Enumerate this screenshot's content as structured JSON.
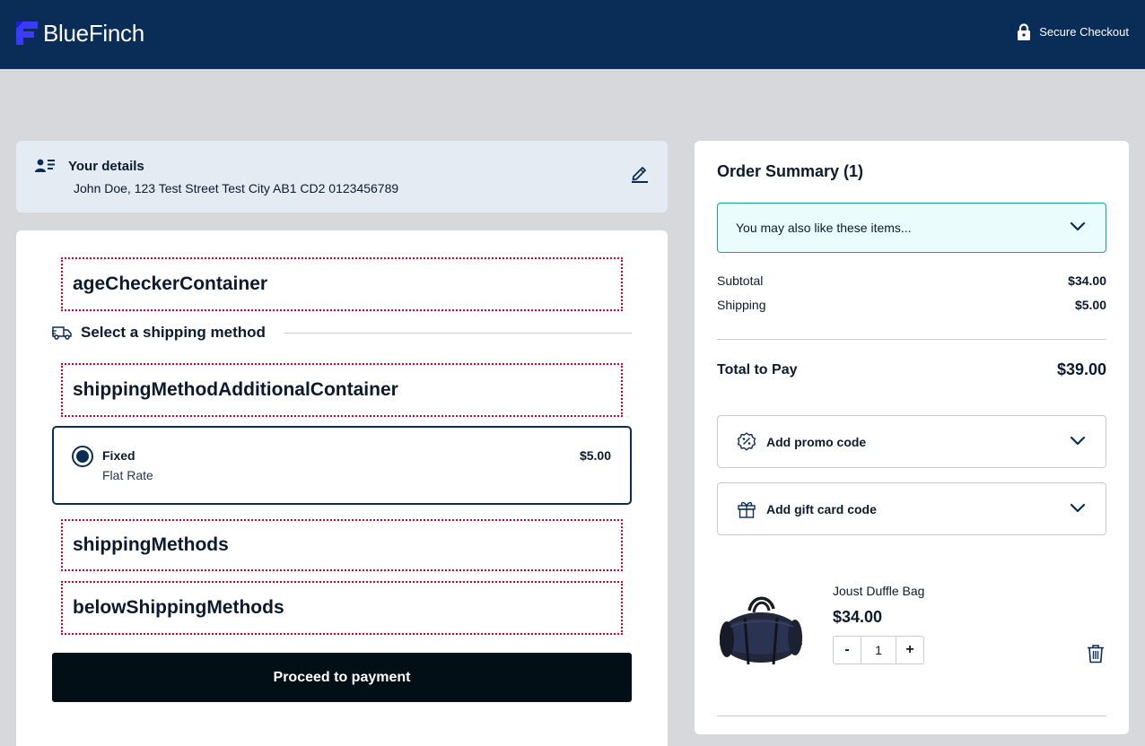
{
  "header": {
    "brand": "BlueFinch",
    "secure_label": "Secure Checkout"
  },
  "details": {
    "title": "Your details",
    "text": "John Doe, 123 Test Street Test City AB1 CD2 0123456789"
  },
  "shipping": {
    "age_checker_label": "ageCheckerContainer",
    "heading": "Select a shipping method",
    "additional_label": "shippingMethodAdditionalContainer",
    "method": {
      "name": "Fixed",
      "sub": "Flat Rate",
      "price": "$5.00"
    },
    "methods_label": "shippingMethods",
    "below_label": "belowShippingMethods",
    "proceed_label": "Proceed to payment"
  },
  "summary": {
    "title": "Order Summary (1)",
    "upsell_text": "You may also like these items...",
    "subtotal_label": "Subtotal",
    "subtotal_value": "$34.00",
    "shipping_label": "Shipping",
    "shipping_value": "$5.00",
    "total_label": "Total to Pay",
    "total_value": "$39.00",
    "promo_label": "Add promo code",
    "gift_label": "Add gift card code",
    "product": {
      "name": "Joust Duffle Bag",
      "price": "$34.00",
      "quantity": "1",
      "minus": "-",
      "plus": "+"
    }
  },
  "colors": {
    "header_bg": "#0a2d58",
    "accent": "#13a79a",
    "placeholder_border": "#d4002a",
    "button_bg": "#030f17"
  }
}
